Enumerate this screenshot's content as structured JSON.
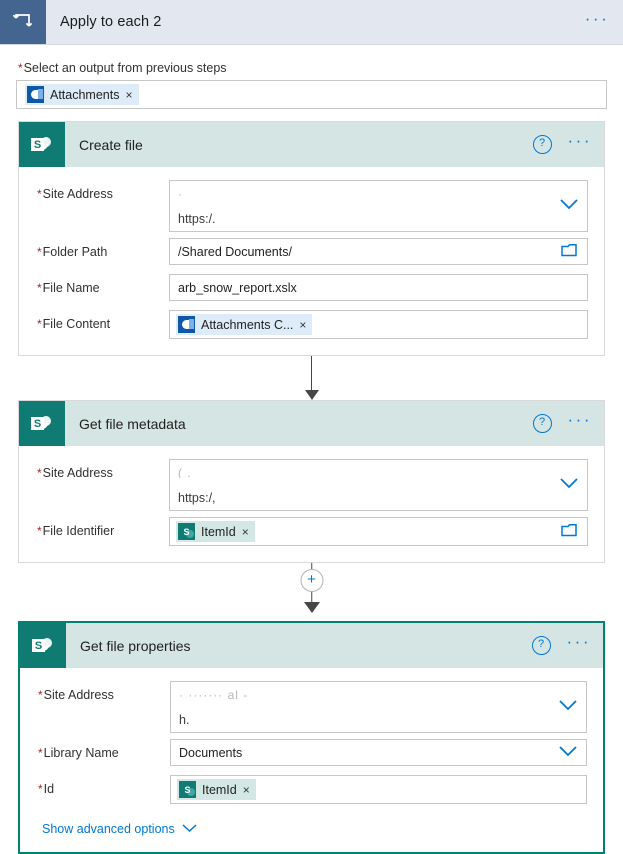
{
  "scope": {
    "icon": "apply-to-each-loop-icon",
    "title": "Apply to each 2",
    "ellipsis": "···",
    "field": {
      "label": "Select an output from previous steps",
      "required_marker": "*",
      "token": {
        "label": "Attachments",
        "icon": "outlook-icon",
        "remove": "×"
      }
    }
  },
  "icons": {
    "help": "?",
    "ellipsis": "···",
    "chevron_down": "chevron-down-icon",
    "folder": "folder-picker-icon",
    "plus": "+",
    "remove": "×",
    "sharepoint_letter": "S"
  },
  "cards": [
    {
      "id": "create-file",
      "title": "Create file",
      "selected": false,
      "rows": [
        {
          "label": "Site Address",
          "required": true,
          "type": "dropdown-tall",
          "redacted_top": "·",
          "value": "https:/.",
          "control": "chevron-down-icon"
        },
        {
          "label": "Folder Path",
          "required": true,
          "type": "text",
          "value": "/Shared Documents/",
          "control": "folder-picker-icon"
        },
        {
          "label": "File Name",
          "required": true,
          "type": "text",
          "value": "arb_snow_report.xslx",
          "control": "none"
        },
        {
          "label": "File Content",
          "required": true,
          "type": "token",
          "token": {
            "label": "Attachments C...",
            "icon": "outlook-icon",
            "remove": "×"
          },
          "control": "none"
        }
      ]
    },
    {
      "id": "get-file-metadata",
      "title": "Get file metadata",
      "selected": false,
      "rows": [
        {
          "label": "Site Address",
          "required": true,
          "type": "dropdown-tall",
          "redacted_top": "(                    .",
          "value": "https:/,",
          "control": "chevron-down-icon"
        },
        {
          "label": "File Identifier",
          "required": true,
          "type": "token",
          "token": {
            "label": "ItemId",
            "icon": "sharepoint-icon",
            "remove": "×"
          },
          "control": "folder-picker-icon"
        }
      ]
    },
    {
      "id": "get-file-properties",
      "title": "Get file properties",
      "selected": true,
      "rows": [
        {
          "label": "Site Address",
          "required": true,
          "type": "dropdown-tall",
          "redacted_top": "·  ·······   al -",
          "value": "h.",
          "control": "chevron-down-icon"
        },
        {
          "label": "Library Name",
          "required": true,
          "type": "dropdown",
          "value": "Documents",
          "control": "chevron-down-icon"
        },
        {
          "label": "Id",
          "required": true,
          "type": "token",
          "token": {
            "label": "ItemId",
            "icon": "sharepoint-icon",
            "remove": "×"
          },
          "control": "none"
        }
      ],
      "advanced_options_label": "Show advanced options"
    }
  ],
  "colors": {
    "scope_header_bg": "#e3e8f0",
    "scope_icon_bg": "#44658f",
    "card_header_bg": "#d5e5e3",
    "sharepoint_teal": "#0f7b73",
    "selection_border": "#008272",
    "link_blue": "#0078d4",
    "required_red": "#a4262c",
    "token_blue_bg": "#deecf9",
    "token_teal_bg": "#d3e8e5"
  }
}
